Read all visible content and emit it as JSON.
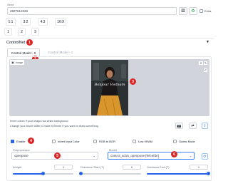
{
  "seed": {
    "label": "Seed",
    "value": "2827612225",
    "extra_label": "Extra"
  },
  "ratio_buttons": [
    "1:1",
    "3:2",
    "4:3",
    "16:9"
  ],
  "count_buttons": [
    "1",
    "2",
    "3"
  ],
  "controlnet": {
    "title": "ControlNet",
    "tabs": [
      "Control Model - 0",
      "Control Model - 1"
    ],
    "image_label": "Image",
    "preview_caption": "Bonjour Vietnam",
    "hint_line1": "Invert colors if your image has white background.",
    "hint_line2": "Change your brush width to make it thinner if you want to draw something.",
    "checkboxes": [
      {
        "label": "Enable",
        "checked": true
      },
      {
        "label": "Invert Input Color",
        "checked": false
      },
      {
        "label": "RGB to BGR",
        "checked": false
      },
      {
        "label": "Low VRAM",
        "checked": false
      },
      {
        "label": "Guess Mode",
        "checked": false
      }
    ],
    "preprocessor": {
      "label": "Preprocessor",
      "value": "openpose"
    },
    "model": {
      "label": "Model",
      "value": "control_sd15_openpose [fefcefde]"
    },
    "sliders": [
      {
        "label": "Weight",
        "value": "1",
        "fraction": 0.5
      },
      {
        "label": "Guidance Start (T)",
        "value": "0",
        "fraction": 0.0
      },
      {
        "label": "Guidance End (T)",
        "value": "1",
        "fraction": 1.0
      }
    ]
  },
  "badges": [
    "1",
    "2",
    "3",
    "4",
    "5",
    "6"
  ],
  "colors": {
    "accent": "#2563eb",
    "badge": "#dc2626",
    "image_bg": "#d1d5db",
    "border": "#d1d5db"
  }
}
